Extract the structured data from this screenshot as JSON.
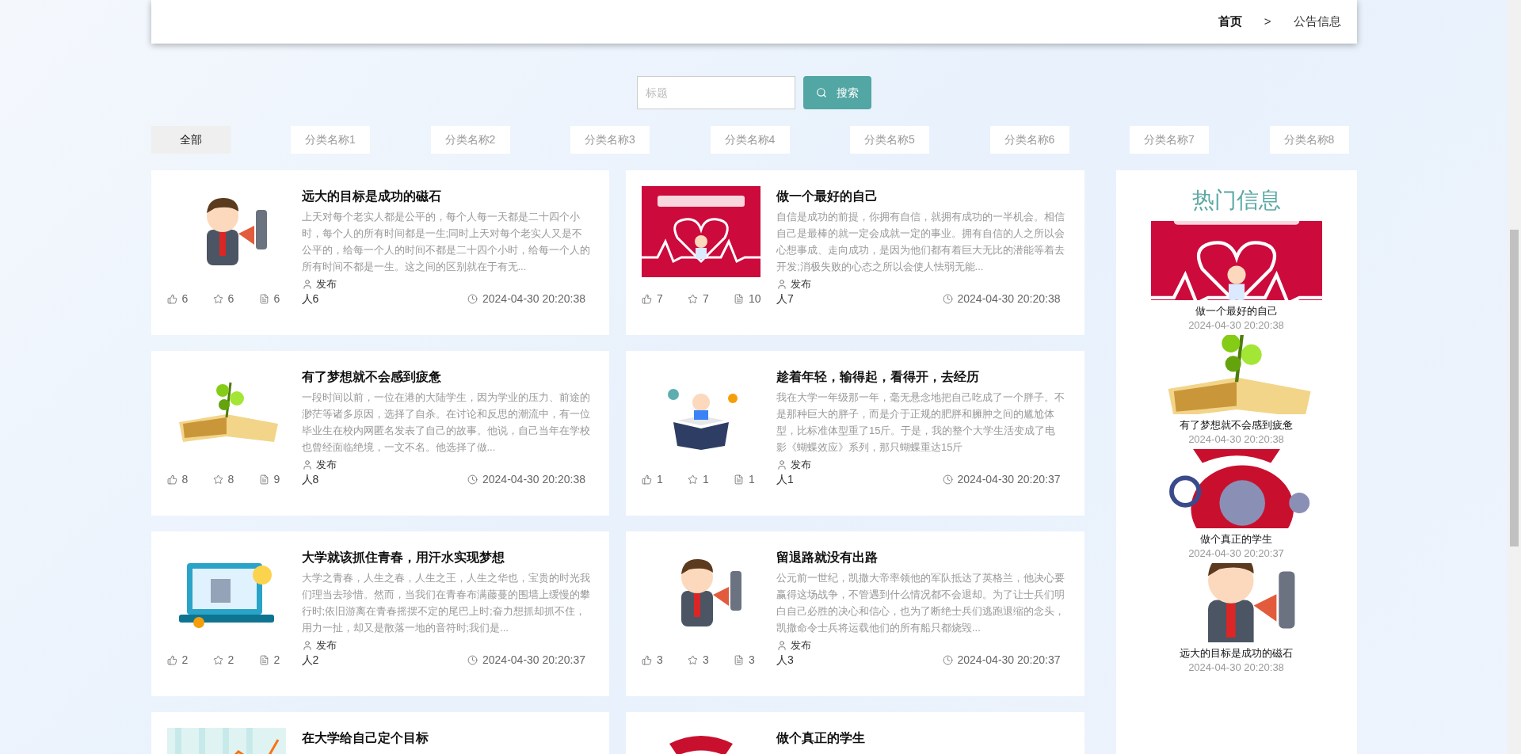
{
  "breadcrumb": [
    {
      "label": "首页",
      "current": false
    },
    {
      "label": "公告信息",
      "current": true
    }
  ],
  "breadcrumb_separator": ">",
  "search": {
    "placeholder": "标题",
    "button": "搜索"
  },
  "categories": [
    {
      "label": "全部",
      "selected": true
    },
    {
      "label": "分类名称1",
      "selected": false
    },
    {
      "label": "分类名称2",
      "selected": false
    },
    {
      "label": "分类名称3",
      "selected": false
    },
    {
      "label": "分类名称4",
      "selected": false
    },
    {
      "label": "分类名称5",
      "selected": false
    },
    {
      "label": "分类名称6",
      "selected": false
    },
    {
      "label": "分类名称7",
      "selected": false
    },
    {
      "label": "分类名称8",
      "selected": false
    }
  ],
  "articles": [
    {
      "title": "远大的目标是成功的磁石",
      "excerpt": "上天对每个老实人都是公平的，每个人每一天都是二十四个小时，每个人的所有时间都是一生;同时上天对每个老实人又是不公平的，给每一个人的时间不都是二十四个小时，给每一个人的所有时间不都是一生。这之间的区别就在于有无...",
      "publish_label": "发布",
      "publisher": "人6",
      "likes": "6",
      "favorites": "6",
      "comments": "6",
      "time": "2024-04-30 20:20:38"
    },
    {
      "title": "做一个最好的自己",
      "excerpt": "自信是成功的前提，你拥有自信，就拥有成功的一半机会。相信自己是最棒的就一定会成就一定的事业。拥有自信的人之所以会心想事成、走向成功，是因为他们都有着巨大无比的潜能等着去开发;消极失败的心态之所以会使人怯弱无能...",
      "publish_label": "发布",
      "publisher": "人7",
      "likes": "7",
      "favorites": "7",
      "comments": "10",
      "time": "2024-04-30 20:20:38"
    },
    {
      "title": "有了梦想就不会感到疲惫",
      "excerpt": "一段时间以前，一位在港的大陆学生，因为学业的压力、前途的渺茫等诸多原因，选择了自杀。在讨论和反思的潮流中，有一位毕业生在校内网匿名发表了自己的故事。他说，自己当年在学校也曾经面临绝境，一文不名。他选择了做...",
      "publish_label": "发布",
      "publisher": "人8",
      "likes": "8",
      "favorites": "8",
      "comments": "9",
      "time": "2024-04-30 20:20:38"
    },
    {
      "title": "趁着年轻，输得起，看得开，去经历",
      "excerpt": "我在大学一年级那一年，毫无悬念地把自己吃成了一个胖子。不是那种巨大的胖子，而是介于正规的肥胖和臃肿之间的尴尬体型，比标准体型重了15斤。于是，我的整个大学生活变成了电影《蝴蝶效应》系列，那只蝴蝶重达15斤",
      "publish_label": "发布",
      "publisher": "人1",
      "likes": "1",
      "favorites": "1",
      "comments": "1",
      "time": "2024-04-30 20:20:37"
    },
    {
      "title": "大学就该抓住青春，用汗水实现梦想",
      "excerpt": "大学之青春，人生之春，人生之王，人生之华也，宝贵的时光我们理当去珍惜。然而，当我们在青春布满藤蔓的围墙上缓慢的攀行时;依旧游离在青春摇摆不定的尾巴上时;奋力想抓却抓不住，用力一扯，却又是散落一地的音符时;我们是...",
      "publish_label": "发布",
      "publisher": "人2",
      "likes": "2",
      "favorites": "2",
      "comments": "2",
      "time": "2024-04-30 20:20:37"
    },
    {
      "title": "留退路就没有出路",
      "excerpt": "公元前一世纪，凯撒大帝率领他的军队抵达了英格兰，他决心要赢得这场战争，不管遇到什么情况都不会退却。为了让士兵们明白自己必胜的决心和信心，也为了断绝士兵们逃跑退缩的念头，凯撒命令士兵将运载他们的所有船只都烧毁...",
      "publish_label": "发布",
      "publisher": "人3",
      "likes": "3",
      "favorites": "3",
      "comments": "3",
      "time": "2024-04-30 20:20:37"
    },
    {
      "title": "在大学给自己定个目标"
    },
    {
      "title": "做个真正的学生"
    }
  ],
  "hot": {
    "title": "热门信息",
    "items": [
      {
        "title": "做一个最好的自己",
        "time": "2024-04-30 20:20:38"
      },
      {
        "title": "有了梦想就不会感到疲惫",
        "time": "2024-04-30 20:20:38"
      },
      {
        "title": "做个真正的学生",
        "time": "2024-04-30 20:20:37"
      },
      {
        "title": "远大的目标是成功的磁石",
        "time": "2024-04-30 20:20:38"
      }
    ]
  }
}
